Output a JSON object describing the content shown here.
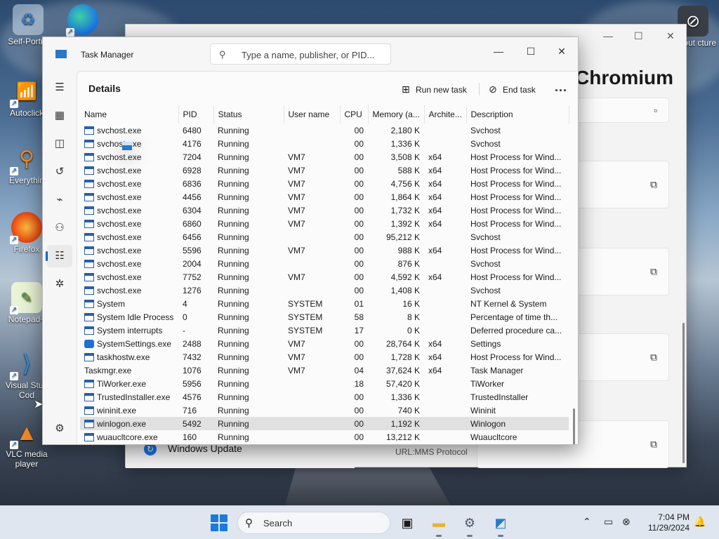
{
  "desktop": {
    "icons": [
      {
        "label": "Self-Portra",
        "icon": "recycle-bin-icon"
      },
      {
        "label": "",
        "icon": "edge-icon"
      },
      {
        "label": "Autoclick",
        "icon": "wifi-icon"
      },
      {
        "label": "Everythin",
        "icon": "magnifier-icon"
      },
      {
        "label": "Firefox",
        "icon": "firefox-icon"
      },
      {
        "label": "Notepad+",
        "icon": "notepadpp-icon"
      },
      {
        "label": "Visual Stud Cod",
        "icon": "vscode-icon"
      },
      {
        "label": "VLC media player",
        "icon": "vlc-icon"
      },
      {
        "label": "bout cture",
        "icon": "sandbox-icon"
      }
    ]
  },
  "background_window": {
    "title": "Chromium",
    "bottom_left": "Windows Update",
    "bottom_right": "URL:MMS Protocol"
  },
  "task_manager": {
    "title": "Task Manager",
    "search_placeholder": "Type a name, publisher, or PID...",
    "page_title": "Details",
    "actions": {
      "run_new_task": "Run new task",
      "end_task": "End task",
      "more": "..."
    },
    "columns": [
      "Name",
      "PID",
      "Status",
      "User name",
      "CPU",
      "Memory (a...",
      "Archite...",
      "Description"
    ],
    "rows": [
      {
        "name": "svchost.exe",
        "pid": "6480",
        "status": "Running",
        "user": "",
        "cpu": "00",
        "mem": "2,180 K",
        "arch": "",
        "desc": "Svchost",
        "icon": "window"
      },
      {
        "name": "svchost.exe",
        "pid": "4176",
        "status": "Running",
        "user": "",
        "cpu": "00",
        "mem": "1,336 K",
        "arch": "",
        "desc": "Svchost",
        "icon": "window"
      },
      {
        "name": "svchost.exe",
        "pid": "7204",
        "status": "Running",
        "user": "VM7",
        "cpu": "00",
        "mem": "3,508 K",
        "arch": "x64",
        "desc": "Host Process for Wind...",
        "icon": "window"
      },
      {
        "name": "svchost.exe",
        "pid": "6928",
        "status": "Running",
        "user": "VM7",
        "cpu": "00",
        "mem": "588 K",
        "arch": "x64",
        "desc": "Host Process for Wind...",
        "icon": "window"
      },
      {
        "name": "svchost.exe",
        "pid": "6836",
        "status": "Running",
        "user": "VM7",
        "cpu": "00",
        "mem": "4,756 K",
        "arch": "x64",
        "desc": "Host Process for Wind...",
        "icon": "window"
      },
      {
        "name": "svchost.exe",
        "pid": "4456",
        "status": "Running",
        "user": "VM7",
        "cpu": "00",
        "mem": "1,864 K",
        "arch": "x64",
        "desc": "Host Process for Wind...",
        "icon": "window"
      },
      {
        "name": "svchost.exe",
        "pid": "6304",
        "status": "Running",
        "user": "VM7",
        "cpu": "00",
        "mem": "1,732 K",
        "arch": "x64",
        "desc": "Host Process for Wind...",
        "icon": "window"
      },
      {
        "name": "svchost.exe",
        "pid": "6860",
        "status": "Running",
        "user": "VM7",
        "cpu": "00",
        "mem": "1,392 K",
        "arch": "x64",
        "desc": "Host Process for Wind...",
        "icon": "window"
      },
      {
        "name": "svchost.exe",
        "pid": "6456",
        "status": "Running",
        "user": "",
        "cpu": "00",
        "mem": "95,212 K",
        "arch": "",
        "desc": "Svchost",
        "icon": "window"
      },
      {
        "name": "svchost.exe",
        "pid": "5596",
        "status": "Running",
        "user": "VM7",
        "cpu": "00",
        "mem": "988 K",
        "arch": "x64",
        "desc": "Host Process for Wind...",
        "icon": "window"
      },
      {
        "name": "svchost.exe",
        "pid": "2004",
        "status": "Running",
        "user": "",
        "cpu": "00",
        "mem": "876 K",
        "arch": "",
        "desc": "Svchost",
        "icon": "window"
      },
      {
        "name": "svchost.exe",
        "pid": "7752",
        "status": "Running",
        "user": "VM7",
        "cpu": "00",
        "mem": "4,592 K",
        "arch": "x64",
        "desc": "Host Process for Wind...",
        "icon": "window"
      },
      {
        "name": "svchost.exe",
        "pid": "1276",
        "status": "Running",
        "user": "",
        "cpu": "00",
        "mem": "1,408 K",
        "arch": "",
        "desc": "Svchost",
        "icon": "window"
      },
      {
        "name": "System",
        "pid": "4",
        "status": "Running",
        "user": "SYSTEM",
        "cpu": "01",
        "mem": "16 K",
        "arch": "",
        "desc": "NT Kernel & System",
        "icon": "window"
      },
      {
        "name": "System Idle Process",
        "pid": "0",
        "status": "Running",
        "user": "SYSTEM",
        "cpu": "58",
        "mem": "8 K",
        "arch": "",
        "desc": "Percentage of time th...",
        "icon": "window"
      },
      {
        "name": "System interrupts",
        "pid": "-",
        "status": "Running",
        "user": "SYSTEM",
        "cpu": "17",
        "mem": "0 K",
        "arch": "",
        "desc": "Deferred procedure ca...",
        "icon": "window"
      },
      {
        "name": "SystemSettings.exe",
        "pid": "2488",
        "status": "Running",
        "user": "VM7",
        "cpu": "00",
        "mem": "28,764 K",
        "arch": "x64",
        "desc": "Settings",
        "icon": "gear"
      },
      {
        "name": "taskhostw.exe",
        "pid": "7432",
        "status": "Running",
        "user": "VM7",
        "cpu": "00",
        "mem": "1,728 K",
        "arch": "x64",
        "desc": "Host Process for Wind...",
        "icon": "window"
      },
      {
        "name": "Taskmgr.exe",
        "pid": "1076",
        "status": "Running",
        "user": "VM7",
        "cpu": "04",
        "mem": "37,624 K",
        "arch": "x64",
        "desc": "Task Manager",
        "icon": "tm"
      },
      {
        "name": "TiWorker.exe",
        "pid": "5956",
        "status": "Running",
        "user": "",
        "cpu": "18",
        "mem": "57,420 K",
        "arch": "",
        "desc": "TiWorker",
        "icon": "window"
      },
      {
        "name": "TrustedInstaller.exe",
        "pid": "4576",
        "status": "Running",
        "user": "",
        "cpu": "00",
        "mem": "1,336 K",
        "arch": "",
        "desc": "TrustedInstaller",
        "icon": "window"
      },
      {
        "name": "wininit.exe",
        "pid": "716",
        "status": "Running",
        "user": "",
        "cpu": "00",
        "mem": "740 K",
        "arch": "",
        "desc": "Wininit",
        "icon": "window"
      },
      {
        "name": "winlogon.exe",
        "pid": "5492",
        "status": "Running",
        "user": "",
        "cpu": "00",
        "mem": "1,192 K",
        "arch": "",
        "desc": "Winlogon",
        "icon": "window",
        "selected": true
      },
      {
        "name": "wuaucltcore.exe",
        "pid": "160",
        "status": "Running",
        "user": "",
        "cpu": "00",
        "mem": "13,212 K",
        "arch": "",
        "desc": "Wuaucltcore",
        "icon": "window"
      }
    ]
  },
  "taskbar": {
    "search_label": "Search",
    "time": "7:04 PM",
    "date": "11/29/2024"
  },
  "colors": {
    "accent": "#0067c0",
    "selected_row": "#e1e1e1"
  }
}
